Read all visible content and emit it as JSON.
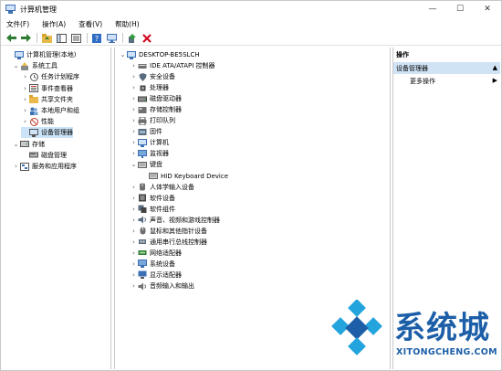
{
  "window": {
    "title": "计算机管理",
    "minimize": "—",
    "maximize": "☐",
    "close": "✕"
  },
  "menu": [
    "文件(F)",
    "操作(A)",
    "查看(V)",
    "帮助(H)"
  ],
  "toolbar": [
    "back-icon",
    "forward-icon",
    "up-folder-icon",
    "console-tree-icon",
    "properties-icon",
    "help-icon",
    "monitor-icon",
    "update-driver-icon",
    "uninstall-icon"
  ],
  "left_tree": [
    {
      "label": "计算机管理(本地)",
      "level": 0,
      "toggle": "",
      "icon": "computer-mgmt-icon"
    },
    {
      "label": "系统工具",
      "level": 1,
      "toggle": "v",
      "icon": "tools-icon"
    },
    {
      "label": "任务计划程序",
      "level": 2,
      "toggle": ">",
      "icon": "clock-icon"
    },
    {
      "label": "事件查看器",
      "level": 2,
      "toggle": ">",
      "icon": "event-icon"
    },
    {
      "label": "共享文件夹",
      "level": 2,
      "toggle": ">",
      "icon": "folder-icon"
    },
    {
      "label": "本地用户和组",
      "level": 2,
      "toggle": ">",
      "icon": "users-icon"
    },
    {
      "label": "性能",
      "level": 2,
      "toggle": ">",
      "icon": "perf-icon"
    },
    {
      "label": "设备管理器",
      "level": 2,
      "toggle": "",
      "icon": "devmgr-icon",
      "selected": true
    },
    {
      "label": "存储",
      "level": 1,
      "toggle": "v",
      "icon": "storage-icon"
    },
    {
      "label": "磁盘管理",
      "level": 2,
      "toggle": "",
      "icon": "disk-icon"
    },
    {
      "label": "服务和应用程序",
      "level": 1,
      "toggle": ">",
      "icon": "services-icon"
    }
  ],
  "device_tree": {
    "root": "DESKTOP-BE5SLCH",
    "items": [
      {
        "label": "IDE ATA/ATAPI 控制器",
        "toggle": ">",
        "icon": "ide-icon"
      },
      {
        "label": "安全设备",
        "toggle": ">",
        "icon": "security-icon"
      },
      {
        "label": "处理器",
        "toggle": ">",
        "icon": "cpu-icon"
      },
      {
        "label": "磁盘驱动器",
        "toggle": ">",
        "icon": "drive-icon"
      },
      {
        "label": "存储控制器",
        "toggle": ">",
        "icon": "storage-ctrl-icon"
      },
      {
        "label": "打印队列",
        "toggle": ">",
        "icon": "printer-icon"
      },
      {
        "label": "固件",
        "toggle": ">",
        "icon": "firmware-icon"
      },
      {
        "label": "计算机",
        "toggle": ">",
        "icon": "computer-icon"
      },
      {
        "label": "监视器",
        "toggle": ">",
        "icon": "monitor-icon"
      },
      {
        "label": "键盘",
        "toggle": "v",
        "icon": "keyboard-icon"
      },
      {
        "label": "HID Keyboard Device",
        "toggle": "",
        "icon": "keyboard-icon",
        "child": true
      },
      {
        "label": "人体学输入设备",
        "toggle": ">",
        "icon": "hid-icon"
      },
      {
        "label": "软件设备",
        "toggle": ">",
        "icon": "software-device-icon"
      },
      {
        "label": "软件组件",
        "toggle": ">",
        "icon": "software-component-icon"
      },
      {
        "label": "声音、视频和游戏控制器",
        "toggle": ">",
        "icon": "sound-icon"
      },
      {
        "label": "鼠标和其他指针设备",
        "toggle": ">",
        "icon": "mouse-icon"
      },
      {
        "label": "通用串行总线控制器",
        "toggle": ">",
        "icon": "usb-icon"
      },
      {
        "label": "网络适配器",
        "toggle": ">",
        "icon": "network-icon"
      },
      {
        "label": "系统设备",
        "toggle": ">",
        "icon": "system-device-icon"
      },
      {
        "label": "显示适配器",
        "toggle": ">",
        "icon": "display-icon"
      },
      {
        "label": "音频输入和输出",
        "toggle": ">",
        "icon": "audio-icon"
      }
    ]
  },
  "actions": {
    "header": "操作",
    "section": "设备管理器",
    "more": "更多操作"
  },
  "watermark": {
    "text": "系统城",
    "sub": "XITONGCHENG.COM"
  },
  "colors": {
    "selection": "#cce4f7",
    "action_section": "#cfe3f5",
    "watermark_blue": "#1c5fa8",
    "close_red": "#d0021b"
  }
}
